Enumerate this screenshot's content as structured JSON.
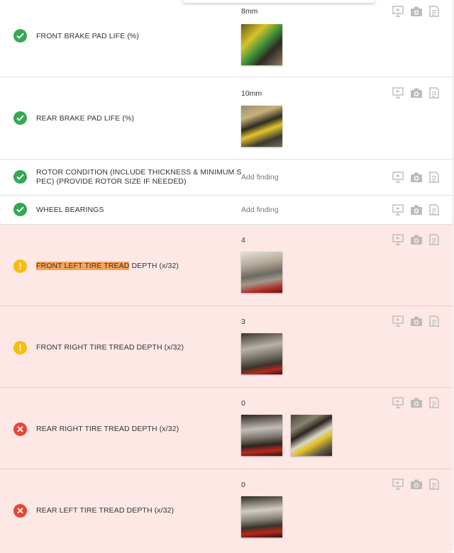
{
  "items": [
    {
      "status": "ok",
      "label": "FRONT BRAKE PAD LIFE (%)",
      "value": "8mm",
      "finding": null
    },
    {
      "status": "ok",
      "label": "REAR BRAKE PAD LIFE (%)",
      "value": "10mm",
      "finding": null
    },
    {
      "status": "ok",
      "label": "ROTOR CONDITION (INCLUDE THICKNESS & MINIMUM S",
      "label_line2": "PEC) (PROVIDE ROTOR SIZE IF NEEDED)",
      "value": null,
      "finding": "Add finding"
    },
    {
      "status": "ok",
      "label": "WHEEL BEARINGS",
      "value": null,
      "finding": "Add finding"
    },
    {
      "status": "warn",
      "label_highlight": "FRONT LEFT TIRE TREAD",
      "label_rest": " DEPTH (x/32)",
      "value": "4",
      "finding": null
    },
    {
      "status": "warn",
      "label": "FRONT RIGHT TIRE TREAD DEPTH (x/32)",
      "value": "3",
      "finding": null
    },
    {
      "status": "fail",
      "label": "REAR RIGHT TIRE TREAD DEPTH (x/32)",
      "value": "0",
      "finding": null
    },
    {
      "status": "fail",
      "label": "REAR LEFT TIRE TREAD DEPTH (x/32)",
      "value": "0",
      "finding": null
    }
  ],
  "icons": {
    "ok": "check-icon",
    "warn": "exclamation-icon",
    "fail": "x-icon",
    "tools": [
      "video-icon",
      "camera-icon",
      "notes-icon"
    ]
  },
  "colors": {
    "ok": "#34a853",
    "warn": "#fbbc05",
    "fail": "#ea4335",
    "alert_row_bg": "#fde8e6",
    "highlight": "#f5a45a"
  },
  "glyphs": {
    "warn": "!",
    "fail": "✕"
  }
}
